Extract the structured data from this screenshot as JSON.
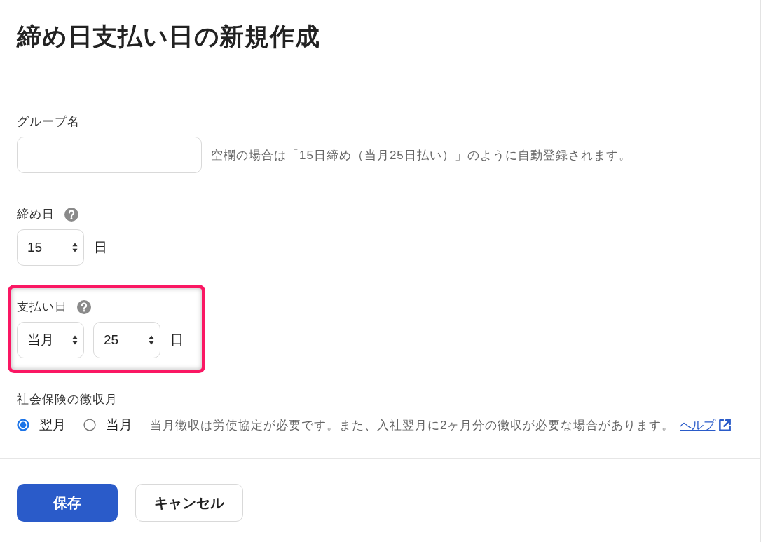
{
  "page": {
    "title": "締め日支払い日の新規作成"
  },
  "fields": [
    {
      "kind": "text",
      "label": "グループ名",
      "help": false,
      "highlighted": false,
      "hint": "空欄の場合は「15日締め（当月25日払い）」のように自動登録されます。"
    },
    {
      "kind": "select",
      "label": "締め日",
      "help": true,
      "highlighted": false,
      "selects": [
        {
          "value": "15"
        }
      ],
      "unit": "日"
    },
    {
      "kind": "select",
      "label": "支払い日",
      "help": true,
      "highlighted": true,
      "selects": [
        {
          "value": "当月"
        },
        {
          "value": "25"
        }
      ],
      "unit": "日"
    },
    {
      "kind": "radio",
      "label": "社会保険の徴収月",
      "help": false,
      "highlighted": false,
      "options": [
        {
          "label": "翌月",
          "selected": true
        },
        {
          "label": "当月",
          "selected": false
        }
      ],
      "note": "当月徴収は労使協定が必要です。また、入社翌月に2ヶ月分の徴収が必要な場合があります。",
      "link": "ヘルプ"
    }
  ],
  "buttons": [
    {
      "label": "保存",
      "kind": "primary"
    },
    {
      "label": "キャンセル",
      "kind": "secondary"
    }
  ]
}
